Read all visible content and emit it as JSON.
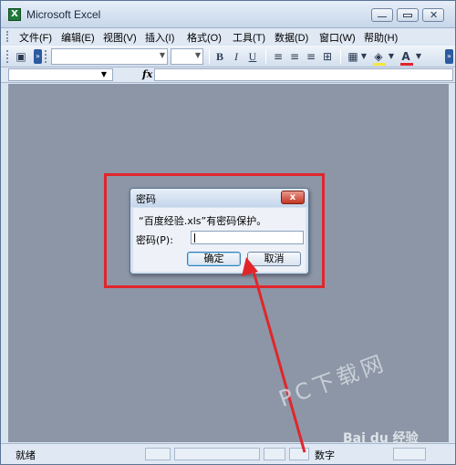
{
  "window": {
    "title": "Microsoft Excel",
    "app_icon": "X"
  },
  "menu": {
    "items": [
      {
        "label": "文件(F)"
      },
      {
        "label": "编辑(E)"
      },
      {
        "label": "视图(V)"
      },
      {
        "label": "插入(I)"
      },
      {
        "label": "格式(O)"
      },
      {
        "label": "工具(T)"
      },
      {
        "label": "数据(D)"
      },
      {
        "label": "窗口(W)"
      },
      {
        "label": "帮助(H)"
      }
    ]
  },
  "toolbar": {
    "bold": "B",
    "italic": "I",
    "underline": "U",
    "font_color_letter": "A",
    "fill_color": "#f6e63a",
    "font_color": "#e0262b"
  },
  "formula_bar": {
    "fx_label": "fx"
  },
  "dialog": {
    "title": "密码",
    "close_glyph": "x",
    "message": "“百度经验.xls”有密码保护。",
    "password_label": "密码(P):",
    "password_value": "",
    "ok_label": "确定",
    "cancel_label": "取消"
  },
  "status": {
    "left": "就绪",
    "num": "数字"
  },
  "colors": {
    "highlight": "#e0262b",
    "arrow": "#e0262b",
    "workspace": "#8d96a6"
  },
  "watermarks": {
    "site": "PC下载网",
    "baidu": "Bai du 经验"
  }
}
